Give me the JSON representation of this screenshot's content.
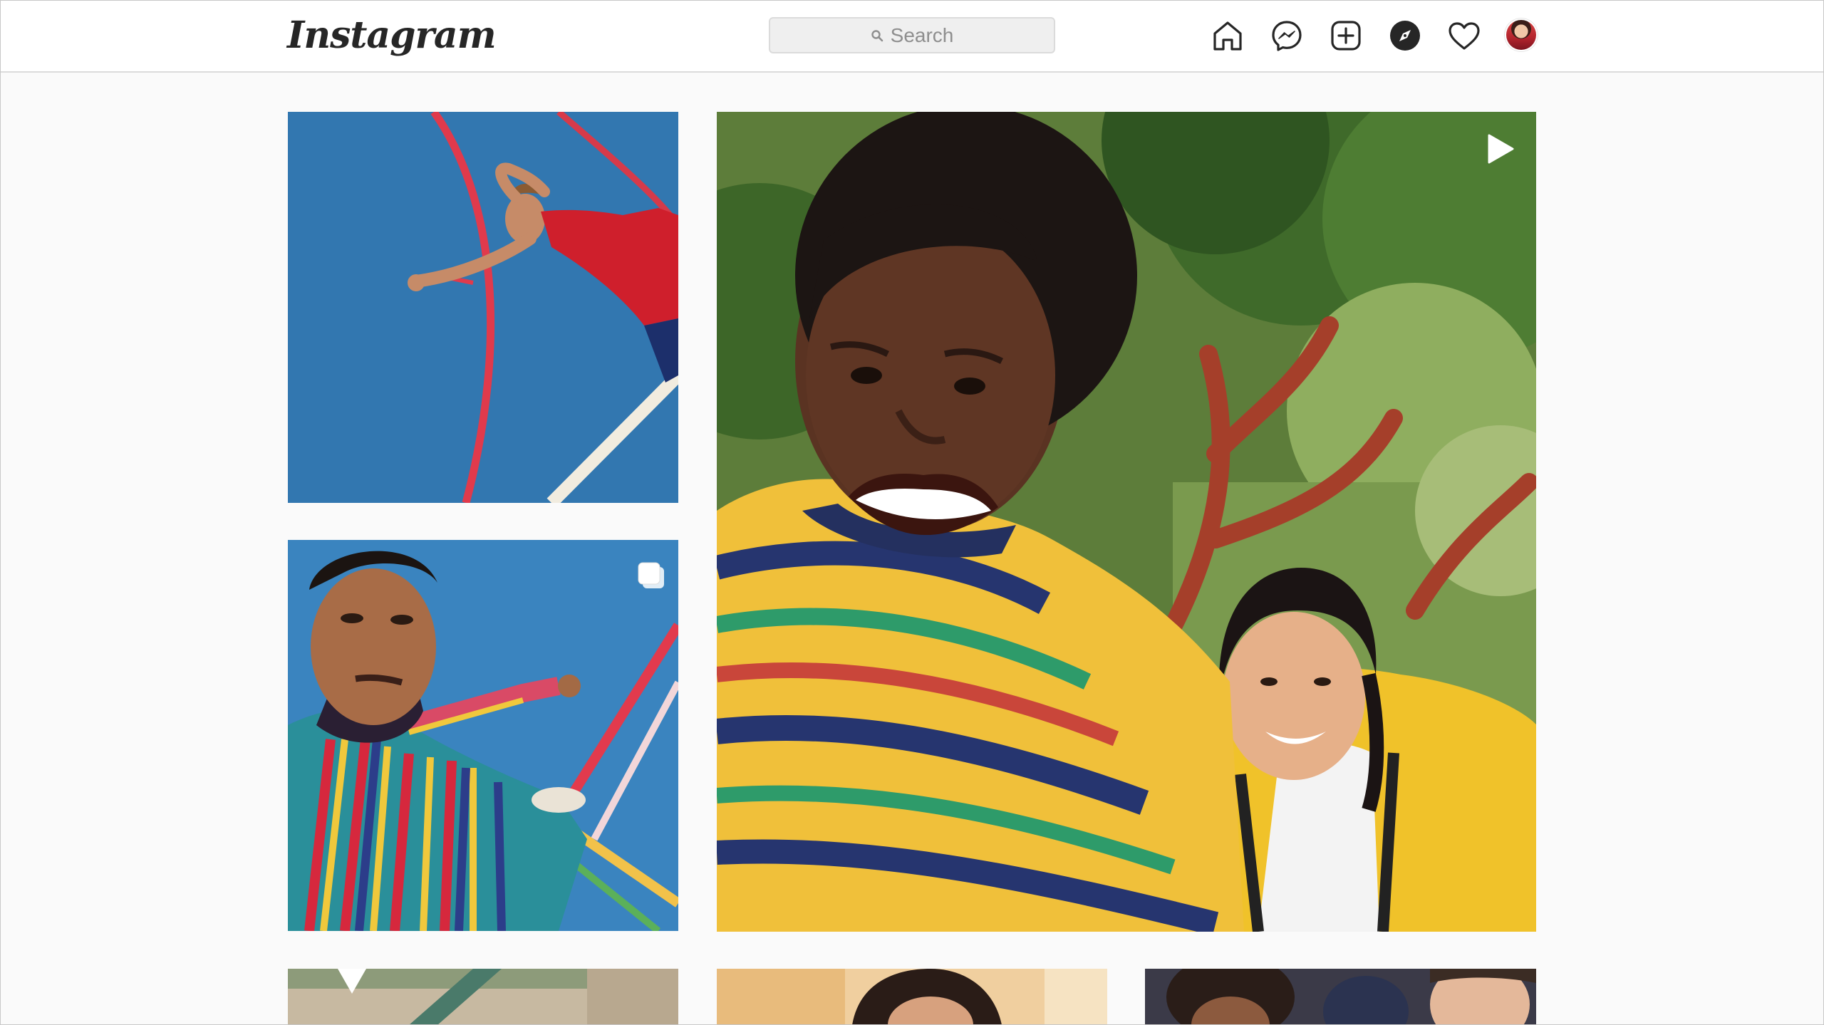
{
  "app": {
    "logo_text": "Instagram"
  },
  "search": {
    "placeholder": "Search"
  },
  "nav": {
    "icons": [
      "home-icon",
      "messenger-icon",
      "new-post-icon",
      "explore-icon",
      "activity-heart-icon",
      "profile-avatar"
    ]
  },
  "colors": {
    "header_bg": "#ffffff",
    "page_bg": "#fafafa",
    "border": "#dbdbdb",
    "icon": "#262626",
    "search_bg": "#efefef",
    "placeholder": "#8e8e8e"
  },
  "posts": [
    {
      "subject": "person lying on blue basketball court",
      "badge": ""
    },
    {
      "subject": "large selfie of two smiling friends under a tree",
      "badge": "video-icon"
    },
    {
      "subject": "young man in striped shirt on blue court",
      "badge": "carousel-icon"
    },
    {
      "subject": "partial photo of court floor",
      "badge": ""
    },
    {
      "subject": "partial photo of person with dark hair",
      "badge": ""
    },
    {
      "subject": "partial photo of group of friends",
      "badge": ""
    }
  ]
}
